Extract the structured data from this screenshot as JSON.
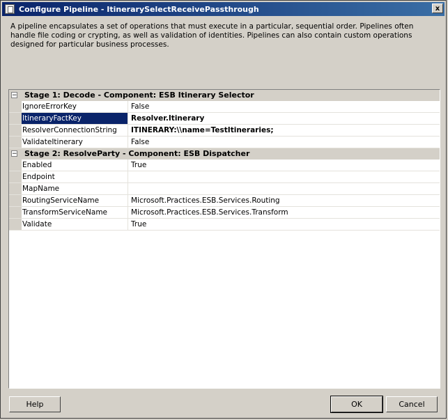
{
  "window": {
    "title": "Configure Pipeline - ItinerarySelectReceivePassthrough",
    "close_glyph": "x"
  },
  "description": "A pipeline encapsulates a set of operations that must execute in a particular, sequential order. Pipelines often handle file coding or crypting, as well as validation of identities. Pipelines can also contain custom operations designed for particular business processes.",
  "stages": [
    {
      "title": "Stage 1: Decode - Component: ESB Itinerary Selector",
      "toggle": "−",
      "rows": [
        {
          "name": "IgnoreErrorKey",
          "value": "False"
        },
        {
          "name": "ItineraryFactKey",
          "value": "Resolver.Itinerary"
        },
        {
          "name": "ResolverConnectionString",
          "value": "ITINERARY:\\\\name=TestItineraries;"
        },
        {
          "name": "ValidateItinerary",
          "value": "False"
        }
      ]
    },
    {
      "title": "Stage 2: ResolveParty - Component: ESB Dispatcher",
      "toggle": "−",
      "rows": [
        {
          "name": "Enabled",
          "value": "True"
        },
        {
          "name": "Endpoint",
          "value": ""
        },
        {
          "name": "MapName",
          "value": ""
        },
        {
          "name": "RoutingServiceName",
          "value": "Microsoft.Practices.ESB.Services.Routing"
        },
        {
          "name": "TransformServiceName",
          "value": "Microsoft.Practices.ESB.Services.Transform"
        },
        {
          "name": "Validate",
          "value": "True"
        }
      ]
    }
  ],
  "buttons": {
    "help": "Help",
    "ok": "OK",
    "cancel": "Cancel"
  }
}
